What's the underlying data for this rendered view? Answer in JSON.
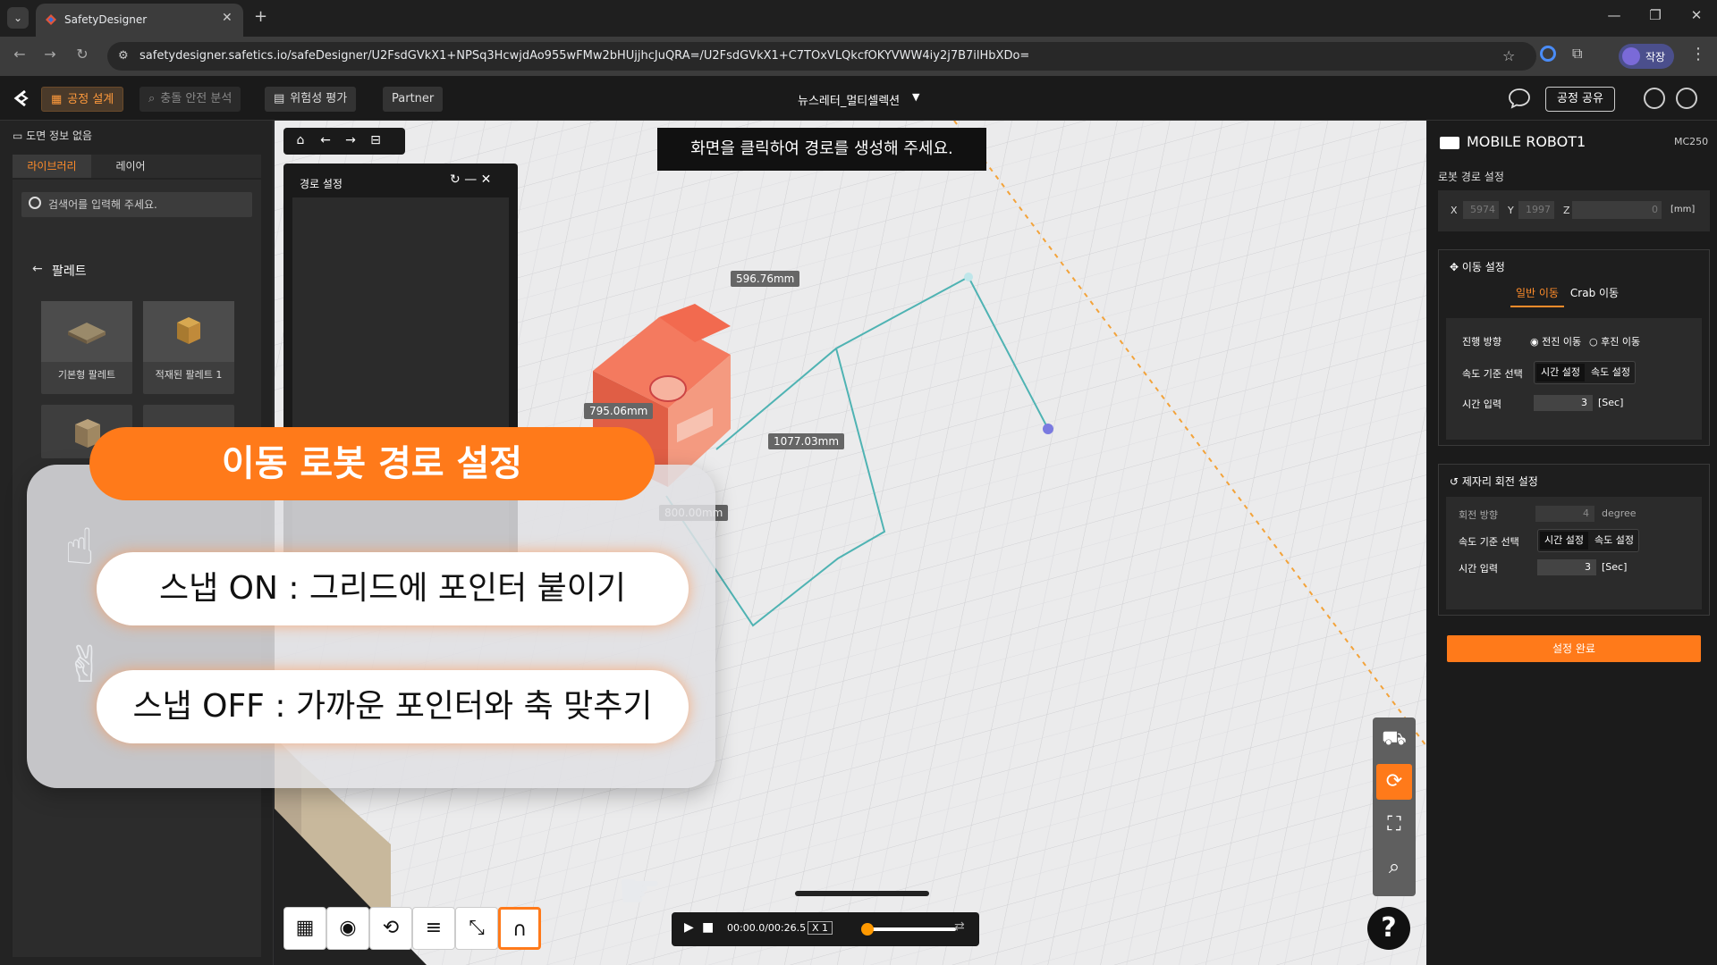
{
  "browser": {
    "tab_title": "SafetyDesigner",
    "url": "safetydesigner.safetics.io/safeDesigner/U2FsdGVkX1+NPSq3HcwjdAo955wFMw2bHUjjhcJuQRA=/U2FsdGVkX1+C7TOxVLQkcfOKYVWW4iy2j7B7ilHbXDo=",
    "profile_label": "작장"
  },
  "header": {
    "btn_design": "공정 설계",
    "btn_collision": "충돌 안전 분석",
    "btn_risk": "위험성 평가",
    "btn_partner": "Partner",
    "project_title": "뉴스레터_멀티셀렉션",
    "btn_share": "공정 공유"
  },
  "left_panel": {
    "drawing_info": "도면 정보 없음",
    "tab_library": "라이브러리",
    "tab_layer": "레이어",
    "search_placeholder": "검색어를 입력해 주세요.",
    "palette_title": "팔레트",
    "items": [
      {
        "label": "기본형 팔레트"
      },
      {
        "label": "적재된 팔레트 1"
      }
    ]
  },
  "viewport": {
    "instruction": "화면을 클릭하여 경로를 생성해 주세요.",
    "path_panel_title": "경로 설정",
    "dimensions": {
      "d1": "596.76mm",
      "d2": "795.06mm",
      "d3": "1077.03mm",
      "d4": "800.00mm"
    },
    "playback": {
      "time": "00:00.0/00:26.5",
      "speed": "X 1",
      "progress": 0.0
    }
  },
  "overlay": {
    "banner": "이동 로봇 경로 설정",
    "snap_on": "스냅 ON : 그리드에 포인터 붙이기",
    "snap_off": "스냅 OFF : 가까운 포인터와 축 맞추기"
  },
  "right_panel": {
    "robot_name": "MOBILE ROBOT1",
    "robot_model": "MC250",
    "route_label": "로봇 경로 설정",
    "coords": {
      "x_label": "X",
      "x_value": "5974",
      "y_label": "Y",
      "y_value": "1997",
      "z_label": "Z",
      "z_value": "0",
      "unit": "[mm]"
    },
    "move": {
      "title": "이동 설정",
      "tab_normal": "일반 이동",
      "tab_crab": "Crab 이동",
      "direction_label": "진행 방향",
      "forward": "전진 이동",
      "backward": "후진 이동",
      "speed_label": "속도 기준 선택",
      "seg_time": "시간 설정",
      "seg_speed": "속도 설정",
      "time_label": "시간 입력",
      "time_value": "3",
      "time_unit": "[Sec]"
    },
    "rotate": {
      "title": "제자리 회전 설정",
      "dir_label": "회전 방향",
      "dir_value": "4",
      "dir_unit": "degree",
      "speed_label": "속도 기준 선택",
      "seg_time": "시간 설정",
      "seg_speed": "속도 설정",
      "time_label": "시간 입력",
      "time_value": "3",
      "time_unit": "[Sec]"
    },
    "done_button": "설정 완료"
  },
  "colors": {
    "accent": "#ff7a1a",
    "path_line": "#4fb3b3",
    "robot": "#f26a4f"
  }
}
